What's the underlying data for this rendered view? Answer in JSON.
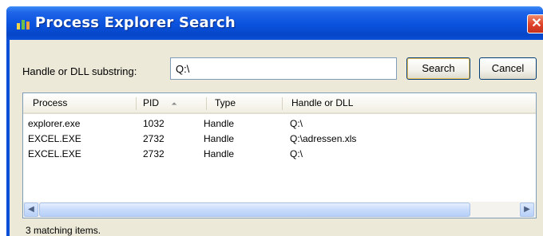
{
  "window": {
    "title": "Process Explorer Search",
    "close_glyph": "✕"
  },
  "search": {
    "label": "Handle or DLL substring:",
    "value": "Q:\\",
    "search_button": "Search",
    "cancel_button": "Cancel"
  },
  "results": {
    "columns": [
      "Process",
      "PID",
      "Type",
      "Handle or DLL"
    ],
    "sort_indicator": "⏶",
    "rows": [
      {
        "process": "explorer.exe",
        "pid": "1032",
        "type": "Handle",
        "handle": "Q:\\"
      },
      {
        "process": "EXCEL.EXE",
        "pid": "2732",
        "type": "Handle",
        "handle": "Q:\\adressen.xls"
      },
      {
        "process": "EXCEL.EXE",
        "pid": "2732",
        "type": "Handle",
        "handle": "Q:\\"
      }
    ]
  },
  "scrollbar": {
    "left_arrow": "◀",
    "right_arrow": "▶"
  },
  "status": {
    "text": "3 matching items."
  },
  "colors": {
    "titlebar": "#0a52dd",
    "client_bg": "#ece9d8",
    "close_button": "#e0452a"
  },
  "icons": {
    "app": "process-explorer-icon",
    "close": "close-icon"
  }
}
